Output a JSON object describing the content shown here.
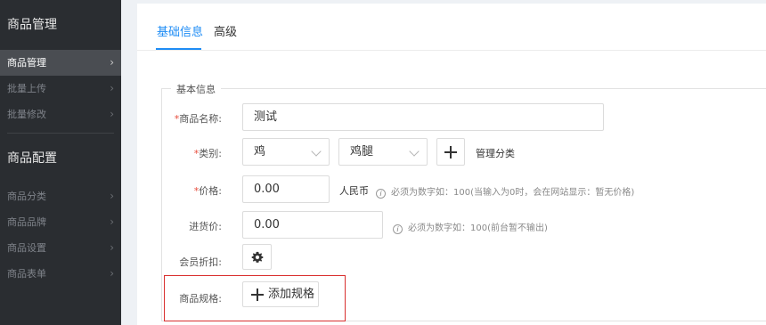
{
  "sidebar": {
    "groups": [
      {
        "title": "商品管理",
        "items": [
          {
            "label": "商品管理",
            "active": true
          },
          {
            "label": "批量上传",
            "active": false
          },
          {
            "label": "批量修改",
            "active": false
          }
        ]
      },
      {
        "title": "商品配置",
        "items": [
          {
            "label": "商品分类",
            "active": false
          },
          {
            "label": "商品品牌",
            "active": false
          },
          {
            "label": "商品设置",
            "active": false
          },
          {
            "label": "商品表单",
            "active": false
          }
        ]
      }
    ],
    "chevron_icon": "chevron-right-icon"
  },
  "tabs": [
    {
      "label": "基础信息",
      "active": true
    },
    {
      "label": "高级",
      "active": false
    }
  ],
  "form": {
    "legend": "基本信息",
    "name": {
      "required_mark": "*",
      "label": "商品名称:",
      "value": "测试"
    },
    "category": {
      "required_mark": "*",
      "label": "类别:",
      "primary_value": "鸡",
      "secondary_value": "鸡腿",
      "add_icon": "plus-icon",
      "manage_label": "管理分类"
    },
    "price": {
      "required_mark": "*",
      "label": "价格:",
      "value": "0.00",
      "unit": "人民币",
      "hint_icon": "info-icon",
      "hint": "必须为数字如：100(当输入为0时，会在网站显示：暂无价格)"
    },
    "cost": {
      "label": "进货价:",
      "value": "0.00",
      "hint_icon": "info-icon",
      "hint": "必须为数字如：100(前台暂不输出)"
    },
    "member_discount": {
      "label": "会员折扣:",
      "icon": "gear-icon"
    },
    "spec": {
      "label": "商品规格:",
      "button_label": "添加规格",
      "button_icon": "plus-icon"
    }
  },
  "colors": {
    "accent": "#1e8cf5",
    "required": "#e74c3c",
    "highlight": "#d9302f",
    "sidebar_bg": "#2a2d31",
    "sidebar_active": "#4a4d52"
  }
}
